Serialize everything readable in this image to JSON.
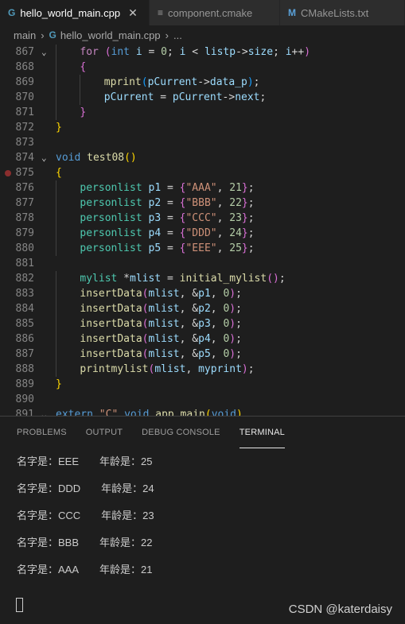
{
  "tabs": [
    {
      "icon": "G",
      "label": "hello_world_main.cpp",
      "close": "✕"
    },
    {
      "icon": "≡",
      "label": "component.cmake"
    },
    {
      "icon": "M",
      "label": "CMakeLists.txt"
    }
  ],
  "breadcrumb": {
    "root": "main",
    "file": "hello_world_main.cpp",
    "tail": "..."
  },
  "code_lines": [
    {
      "n": "867",
      "fold": "⌄",
      "indent": 4,
      "tokens": [
        [
          "kw",
          "for"
        ],
        [
          "op",
          " "
        ],
        [
          "p2",
          "("
        ],
        [
          "ty",
          "int"
        ],
        [
          "op",
          " "
        ],
        [
          "var",
          "i"
        ],
        [
          "op",
          " = "
        ],
        [
          "num",
          "0"
        ],
        [
          "op",
          "; "
        ],
        [
          "var",
          "i"
        ],
        [
          "op",
          " < "
        ],
        [
          "var",
          "listp"
        ],
        [
          "op",
          "->"
        ],
        [
          "var",
          "size"
        ],
        [
          "op",
          "; "
        ],
        [
          "var",
          "i"
        ],
        [
          "op",
          "++"
        ],
        [
          "p2",
          ")"
        ]
      ]
    },
    {
      "n": "868",
      "indent": 4,
      "tokens": [
        [
          "p2",
          "{"
        ]
      ]
    },
    {
      "n": "869",
      "indent": 8,
      "tokens": [
        [
          "fn",
          "mprint"
        ],
        [
          "p3",
          "("
        ],
        [
          "var",
          "pCurrent"
        ],
        [
          "op",
          "->"
        ],
        [
          "var",
          "data_p"
        ],
        [
          "p3",
          ")"
        ],
        [
          "op",
          ";"
        ]
      ]
    },
    {
      "n": "870",
      "indent": 8,
      "tokens": [
        [
          "var",
          "pCurrent"
        ],
        [
          "op",
          " = "
        ],
        [
          "var",
          "pCurrent"
        ],
        [
          "op",
          "->"
        ],
        [
          "var",
          "next"
        ],
        [
          "op",
          ";"
        ]
      ]
    },
    {
      "n": "871",
      "indent": 4,
      "tokens": [
        [
          "p2",
          "}"
        ]
      ]
    },
    {
      "n": "872",
      "indent": 0,
      "tokens": [
        [
          "p1",
          "}"
        ]
      ]
    },
    {
      "n": "873",
      "indent": 0,
      "tokens": []
    },
    {
      "n": "874",
      "fold": "⌄",
      "indent": 0,
      "tokens": [
        [
          "ty",
          "void"
        ],
        [
          "op",
          " "
        ],
        [
          "fn",
          "test08"
        ],
        [
          "p1",
          "()"
        ]
      ]
    },
    {
      "n": "875",
      "bp": true,
      "indent": 0,
      "tokens": [
        [
          "p1",
          "{"
        ]
      ]
    },
    {
      "n": "876",
      "indent": 4,
      "tokens": [
        [
          "tp",
          "personlist"
        ],
        [
          "op",
          " "
        ],
        [
          "var",
          "p1"
        ],
        [
          "op",
          " = "
        ],
        [
          "p2",
          "{"
        ],
        [
          "str",
          "\"AAA\""
        ],
        [
          "op",
          ", "
        ],
        [
          "num",
          "21"
        ],
        [
          "p2",
          "}"
        ],
        [
          "op",
          ";"
        ]
      ]
    },
    {
      "n": "877",
      "indent": 4,
      "tokens": [
        [
          "tp",
          "personlist"
        ],
        [
          "op",
          " "
        ],
        [
          "var",
          "p2"
        ],
        [
          "op",
          " = "
        ],
        [
          "p2",
          "{"
        ],
        [
          "str",
          "\"BBB\""
        ],
        [
          "op",
          ", "
        ],
        [
          "num",
          "22"
        ],
        [
          "p2",
          "}"
        ],
        [
          "op",
          ";"
        ]
      ]
    },
    {
      "n": "878",
      "indent": 4,
      "tokens": [
        [
          "tp",
          "personlist"
        ],
        [
          "op",
          " "
        ],
        [
          "var",
          "p3"
        ],
        [
          "op",
          " = "
        ],
        [
          "p2",
          "{"
        ],
        [
          "str",
          "\"CCC\""
        ],
        [
          "op",
          ", "
        ],
        [
          "num",
          "23"
        ],
        [
          "p2",
          "}"
        ],
        [
          "op",
          ";"
        ]
      ]
    },
    {
      "n": "879",
      "indent": 4,
      "tokens": [
        [
          "tp",
          "personlist"
        ],
        [
          "op",
          " "
        ],
        [
          "var",
          "p4"
        ],
        [
          "op",
          " = "
        ],
        [
          "p2",
          "{"
        ],
        [
          "str",
          "\"DDD\""
        ],
        [
          "op",
          ", "
        ],
        [
          "num",
          "24"
        ],
        [
          "p2",
          "}"
        ],
        [
          "op",
          ";"
        ]
      ]
    },
    {
      "n": "880",
      "indent": 4,
      "tokens": [
        [
          "tp",
          "personlist"
        ],
        [
          "op",
          " "
        ],
        [
          "var",
          "p5"
        ],
        [
          "op",
          " = "
        ],
        [
          "p2",
          "{"
        ],
        [
          "str",
          "\"EEE\""
        ],
        [
          "op",
          ", "
        ],
        [
          "num",
          "25"
        ],
        [
          "p2",
          "}"
        ],
        [
          "op",
          ";"
        ]
      ]
    },
    {
      "n": "881",
      "indent": 0,
      "tokens": []
    },
    {
      "n": "882",
      "indent": 4,
      "tokens": [
        [
          "tp",
          "mylist"
        ],
        [
          "op",
          " *"
        ],
        [
          "var",
          "mlist"
        ],
        [
          "op",
          " = "
        ],
        [
          "fn",
          "initial_mylist"
        ],
        [
          "p2",
          "()"
        ],
        [
          "op",
          ";"
        ]
      ]
    },
    {
      "n": "883",
      "indent": 4,
      "tokens": [
        [
          "fn",
          "insertData"
        ],
        [
          "p2",
          "("
        ],
        [
          "var",
          "mlist"
        ],
        [
          "op",
          ", &"
        ],
        [
          "var",
          "p1"
        ],
        [
          "op",
          ", "
        ],
        [
          "num",
          "0"
        ],
        [
          "p2",
          ")"
        ],
        [
          "op",
          ";"
        ]
      ]
    },
    {
      "n": "884",
      "indent": 4,
      "tokens": [
        [
          "fn",
          "insertData"
        ],
        [
          "p2",
          "("
        ],
        [
          "var",
          "mlist"
        ],
        [
          "op",
          ", &"
        ],
        [
          "var",
          "p2"
        ],
        [
          "op",
          ", "
        ],
        [
          "num",
          "0"
        ],
        [
          "p2",
          ")"
        ],
        [
          "op",
          ";"
        ]
      ]
    },
    {
      "n": "885",
      "indent": 4,
      "tokens": [
        [
          "fn",
          "insertData"
        ],
        [
          "p2",
          "("
        ],
        [
          "var",
          "mlist"
        ],
        [
          "op",
          ", &"
        ],
        [
          "var",
          "p3"
        ],
        [
          "op",
          ", "
        ],
        [
          "num",
          "0"
        ],
        [
          "p2",
          ")"
        ],
        [
          "op",
          ";"
        ]
      ]
    },
    {
      "n": "886",
      "indent": 4,
      "tokens": [
        [
          "fn",
          "insertData"
        ],
        [
          "p2",
          "("
        ],
        [
          "var",
          "mlist"
        ],
        [
          "op",
          ", &"
        ],
        [
          "var",
          "p4"
        ],
        [
          "op",
          ", "
        ],
        [
          "num",
          "0"
        ],
        [
          "p2",
          ")"
        ],
        [
          "op",
          ";"
        ]
      ]
    },
    {
      "n": "887",
      "indent": 4,
      "tokens": [
        [
          "fn",
          "insertData"
        ],
        [
          "p2",
          "("
        ],
        [
          "var",
          "mlist"
        ],
        [
          "op",
          ", &"
        ],
        [
          "var",
          "p5"
        ],
        [
          "op",
          ", "
        ],
        [
          "num",
          "0"
        ],
        [
          "p2",
          ")"
        ],
        [
          "op",
          ";"
        ]
      ]
    },
    {
      "n": "888",
      "indent": 4,
      "tokens": [
        [
          "fn",
          "printmylist"
        ],
        [
          "p2",
          "("
        ],
        [
          "var",
          "mlist"
        ],
        [
          "op",
          ", "
        ],
        [
          "var",
          "myprint"
        ],
        [
          "p2",
          ")"
        ],
        [
          "op",
          ";"
        ]
      ]
    },
    {
      "n": "889",
      "indent": 0,
      "tokens": [
        [
          "p1",
          "}"
        ]
      ]
    },
    {
      "n": "890",
      "indent": 0,
      "tokens": []
    },
    {
      "n": "891",
      "fold": "⌄",
      "indent": 0,
      "tokens": [
        [
          "ty",
          "extern"
        ],
        [
          "op",
          " "
        ],
        [
          "str",
          "\"C\""
        ],
        [
          "op",
          " "
        ],
        [
          "ty",
          "void"
        ],
        [
          "op",
          " "
        ],
        [
          "fn",
          "app_main"
        ],
        [
          "p1",
          "("
        ],
        [
          "ty",
          "void"
        ],
        [
          "p1",
          ")"
        ]
      ]
    }
  ],
  "panel_tabs": [
    "PROBLEMS",
    "OUTPUT",
    "DEBUG CONSOLE",
    "TERMINAL"
  ],
  "active_panel_tab": "TERMINAL",
  "terminal_lines": [
    {
      "name": "名字是：EEE",
      "age": "年龄是：25"
    },
    {
      "name": "名字是：DDD",
      "age": "年龄是：24"
    },
    {
      "name": "名字是：CCC",
      "age": "年龄是：23"
    },
    {
      "name": "名字是：BBB",
      "age": "年龄是：22"
    },
    {
      "name": "名字是：AAA",
      "age": "年龄是：21"
    }
  ],
  "watermark": "CSDN @katerdaisy"
}
